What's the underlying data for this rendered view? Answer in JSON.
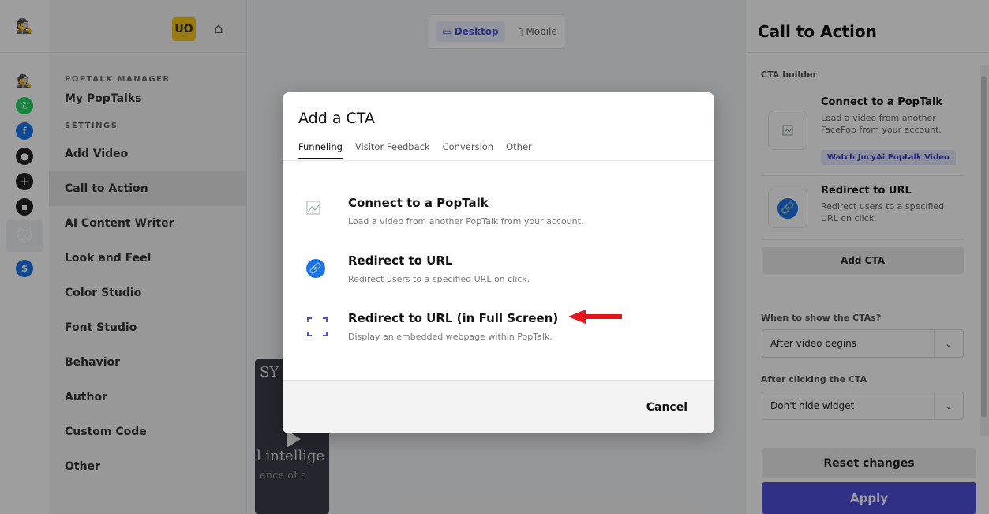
{
  "viewToggle": {
    "desktop": "Desktop",
    "mobile": "Mobile"
  },
  "user": {
    "initials": "UO"
  },
  "nav": {
    "section1": "POPTALK MANAGER",
    "myPoptalks": "My PopTalks",
    "section2": "SETTINGS",
    "items": [
      "Add Video",
      "Call to Action",
      "AI Content Writer",
      "Look and Feel",
      "Color Studio",
      "Font Studio",
      "Behavior",
      "Author",
      "Custom Code",
      "Other"
    ]
  },
  "video": {
    "line1": "SY",
    "line2": "l intellige",
    "line3": "ence of a"
  },
  "right": {
    "title": "Call to Action",
    "ctaBuilder": "CTA builder",
    "card1": {
      "title": "Connect to a PopTalk",
      "desc": "Load a video from another FacePop from your account.",
      "badge": "Watch JucyAi Poptalk Video"
    },
    "card2": {
      "title": "Redirect to URL",
      "desc": "Redirect users to a specified URL on click."
    },
    "addCta": "Add CTA",
    "whenLabel": "When to show the CTAs?",
    "whenValue": "After video begins",
    "afterLabel": "After clicking the CTA",
    "afterValue": "Don't hide widget",
    "reset": "Reset changes",
    "apply": "Apply"
  },
  "modal": {
    "title": "Add a CTA",
    "tabs": [
      "Funneling",
      "Visitor Feedback",
      "Conversion",
      "Other"
    ],
    "options": [
      {
        "title": "Connect to a PopTalk",
        "desc": "Load a video from another PopTalk from your account."
      },
      {
        "title": "Redirect to URL",
        "desc": "Redirect users to a specified URL on click."
      },
      {
        "title": "Redirect to URL (in Full Screen)",
        "desc": "Display an embedded webpage within PopTalk."
      }
    ],
    "cancel": "Cancel"
  },
  "colors": {
    "accent": "#4e4fd8",
    "arrow": "#e3141b",
    "badge": "#f5c518"
  }
}
